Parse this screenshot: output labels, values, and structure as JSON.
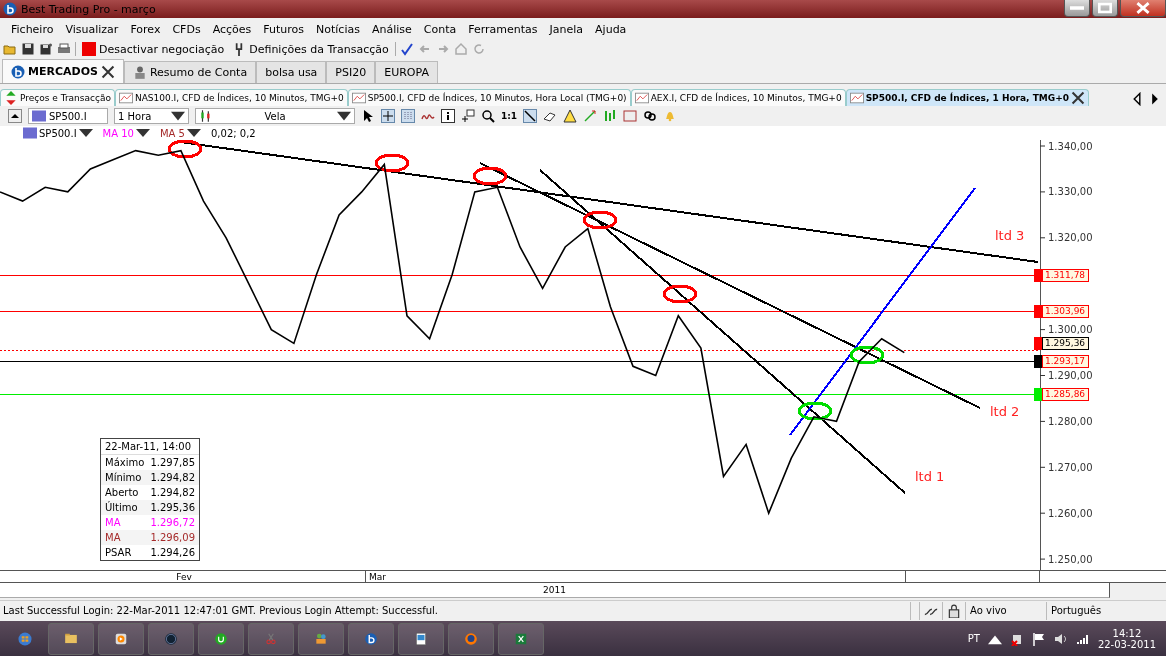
{
  "window": {
    "title": "Best Trading Pro - março"
  },
  "menu": [
    "Ficheiro",
    "Visualizar",
    "Forex",
    "CFDs",
    "Acções",
    "Futuros",
    "Notícias",
    "Análise",
    "Conta",
    "Ferramentas",
    "Janela",
    "Ajuda"
  ],
  "toolbar": {
    "buttons": [
      {
        "label": "Desactivar negociação",
        "kind": "stop"
      },
      {
        "label": "Definições da Transacção",
        "kind": "settings"
      }
    ]
  },
  "market_tabs": [
    {
      "label": "MERCADOS",
      "selected": true
    },
    {
      "label": "Resumo de Conta",
      "selected": false
    },
    {
      "label": "bolsa usa",
      "selected": false
    },
    {
      "label": "PSI20",
      "selected": false
    },
    {
      "label": "EUROPA",
      "selected": false
    }
  ],
  "chart_tabs": [
    {
      "label": "Preços e Transacção",
      "selected": false
    },
    {
      "label": "NAS100.I, CFD de Índices, 10 Minutos, TMG+0",
      "selected": false
    },
    {
      "label": "SP500.I, CFD de Índices, 10 Minutos, Hora Local (TMG+0)",
      "selected": false
    },
    {
      "label": "AEX.I, CFD de Índices, 10 Minutos, TMG+0",
      "selected": false
    },
    {
      "label": "SP500.I, CFD de Índices, 1 Hora, TMG+0",
      "selected": true
    }
  ],
  "chart_toolbar": {
    "symbol": "SP500.I",
    "timeframe": "1 Hora",
    "chart_type": "Vela",
    "zoom_label": "1:1"
  },
  "indicators": [
    {
      "label": "MA 10",
      "color": "#ff00ff"
    },
    {
      "label": "MA 5",
      "color": "#a52a2a"
    },
    {
      "label": "0,02; 0,2",
      "color": "#000000"
    }
  ],
  "chart": {
    "series_label": "SP500.I",
    "price_axis": [
      "1.340,00",
      "1.330,00",
      "1.320,00",
      "1.300,00",
      "1.290,00",
      "1.280,00",
      "1.270,00",
      "1.260,00",
      "1.250,00"
    ],
    "price_lines": [
      {
        "color": "#ff0000",
        "kind": "solid",
        "tag": {
          "label": "1.311,78",
          "color": "#ff0000"
        }
      },
      {
        "color": "#ff0000",
        "kind": "solid",
        "tag": {
          "label": "1.303,96",
          "color": "#ff0000"
        }
      },
      {
        "color": "#ff0000",
        "kind": "dotted",
        "tag": {
          "label": "1.295,36",
          "color": "#000000"
        }
      },
      {
        "color": "#000000",
        "kind": "solid",
        "tag": {
          "label": "1.293,17",
          "color": "#ff0000"
        }
      },
      {
        "color": "#00ee00",
        "kind": "solid",
        "tag": {
          "label": "1.285,86",
          "color": "#ff0000"
        }
      }
    ],
    "trend_lines": [
      {
        "label": "ltd 3",
        "color": "#000000"
      },
      {
        "label": "ltd 2",
        "color": "#000000"
      },
      {
        "label": "ltd 1",
        "color": "#000000"
      },
      {
        "color": "#0000ff"
      }
    ],
    "markers": [
      {
        "color": "#ff0000"
      },
      {
        "color": "#ff0000"
      },
      {
        "color": "#ff0000"
      },
      {
        "color": "#ff0000"
      },
      {
        "color": "#ff0000"
      },
      {
        "color": "#00dd00"
      },
      {
        "color": "#00dd00"
      }
    ],
    "info_box": {
      "title": "22-Mar-11, 14:00",
      "rows": [
        {
          "name": "Máximo",
          "value": "1.297,85",
          "color": "#000000"
        },
        {
          "name": "Mínimo",
          "value": "1.294,82",
          "color": "#000000"
        },
        {
          "name": "Aberto",
          "value": "1.294,82",
          "color": "#000000"
        },
        {
          "name": "Último",
          "value": "1.295,36",
          "color": "#000000"
        },
        {
          "name": "MA",
          "value": "1.296,72",
          "color": "#ff00ff"
        },
        {
          "name": "MA",
          "value": "1.296,09",
          "color": "#a52a2a"
        },
        {
          "name": "PSAR",
          "value": "1.294,26",
          "color": "#000000"
        }
      ]
    },
    "x_labels": [
      "Fev",
      "Mar"
    ],
    "year": "2011"
  },
  "status_bar": {
    "message": "Last Successful Login: 22-Mar-2011 12:47:01 GMT. Previous Login Attempt: Successful.",
    "connection": "Ao vivo",
    "language": "Português"
  },
  "taskbar": {
    "language": "PT",
    "time": "14:12",
    "date": "22-03-2011"
  }
}
